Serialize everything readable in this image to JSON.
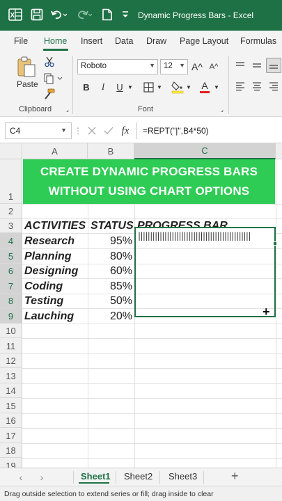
{
  "titlebar": {
    "title": "Dynamic Progress Bars  -  Excel",
    "icons": [
      "excel-logo-icon",
      "save-icon",
      "undo-icon",
      "redo-icon",
      "new-file-icon",
      "customize-qat-icon"
    ]
  },
  "ribbon_tabs": [
    "File",
    "Home",
    "Insert",
    "Data",
    "Draw",
    "Page Layout",
    "Formulas"
  ],
  "ribbon": {
    "paste_label": "Paste",
    "clipboard_label": "Clipboard",
    "font_label": "Font",
    "font_name": "Roboto",
    "font_size": "12",
    "grow_font": "A^",
    "shrink_font": "A^",
    "bold": "B",
    "italic": "I",
    "underline": "U",
    "font_color_glyph": "A"
  },
  "formula_bar": {
    "name_box": "C4",
    "fx": "fx",
    "formula": "=REPT(\"|\",B4*50)"
  },
  "columns": [
    "A",
    "B",
    "C"
  ],
  "rows": [
    "1",
    "2",
    "3",
    "4",
    "5",
    "6",
    "7",
    "8",
    "9",
    "10",
    "11",
    "12",
    "13",
    "14",
    "15",
    "16",
    "17",
    "18",
    "19"
  ],
  "banner": {
    "line1": "CREATE DYNAMIC PROGRESS BARS",
    "line2": "WITHOUT USING CHART OPTIONS"
  },
  "headers": {
    "activities": "ACTIVITIES",
    "status": "STATUS",
    "progress": "PROGRESS BAR"
  },
  "table": [
    {
      "activity": "Research",
      "status": "95%",
      "progress": 0.95
    },
    {
      "activity": "Planning",
      "status": "80%",
      "progress": 0.8
    },
    {
      "activity": "Designing",
      "status": "60%",
      "progress": 0.6
    },
    {
      "activity": "Coding",
      "status": "85%",
      "progress": 0.85
    },
    {
      "activity": "Testing",
      "status": "50%",
      "progress": 0.5
    },
    {
      "activity": "Lauching",
      "status": "20%",
      "progress": 0.2
    }
  ],
  "progress_bar_text": "|||||||||||||||||||||||||||||||||||||||||||||||",
  "sheets": [
    "Sheet1",
    "Sheet2",
    "Sheet3"
  ],
  "add_sheet": "+",
  "status_bar": "Drag outside selection to extend series or fill; drag inside to clear",
  "colors": {
    "accent": "#1e7145",
    "banner": "#2ecc55"
  }
}
